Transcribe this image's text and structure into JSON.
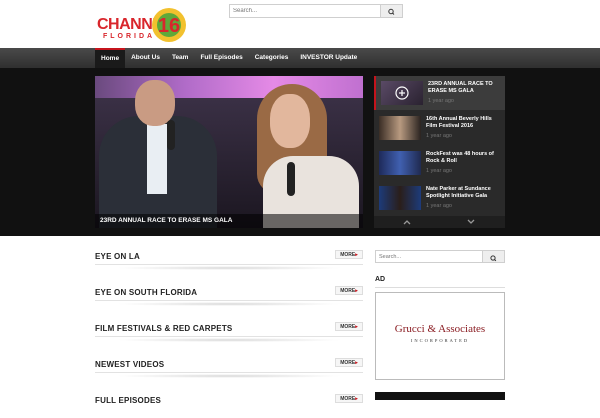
{
  "header": {
    "logo": {
      "word": "CHANNEL",
      "number": "16",
      "sub": "FLORIDA"
    },
    "search": {
      "placeholder": "Search..."
    }
  },
  "nav": {
    "items": [
      {
        "label": "Home",
        "active": true
      },
      {
        "label": "About Us"
      },
      {
        "label": "Team"
      },
      {
        "label": "Full Episodes"
      },
      {
        "label": "Categories"
      },
      {
        "label": "INVESTOR Update"
      }
    ]
  },
  "feature": {
    "main_caption": "23RD ANNUAL RACE TO ERASE MS GALA",
    "list": [
      {
        "title": "23RD ANNUAL RACE TO ERASE MS GALA",
        "time": "1 year ago",
        "active": true
      },
      {
        "title": "16th Annual Beverly Hills Film Festival 2016",
        "time": "1 year ago"
      },
      {
        "title": "RockFest was 48 hours of Rock & Roll",
        "time": "1 year ago"
      },
      {
        "title": "Nate Parker at Sundance Spotlight Initiative Gala",
        "time": "1 year ago"
      }
    ]
  },
  "sections": [
    {
      "label": "EYE ON LA",
      "more": "MORE"
    },
    {
      "label": "EYE ON SOUTH FLORIDA",
      "more": "MORE"
    },
    {
      "label": "FILM FESTIVALS & RED CARPETS",
      "more": "MORE"
    },
    {
      "label": "NEWEST VIDEOS",
      "more": "MORE"
    },
    {
      "label": "FULL EPISODES",
      "more": "MORE"
    }
  ],
  "sidebar": {
    "search": {
      "placeholder": "Search..."
    },
    "ad_label": "AD",
    "ad": {
      "brand": "Grucci & Associates",
      "sub": "INCORPORATED"
    }
  },
  "colors": {
    "accent": "#c5141c",
    "nav": "#3a3a3a",
    "feature_bg": "#111111"
  }
}
